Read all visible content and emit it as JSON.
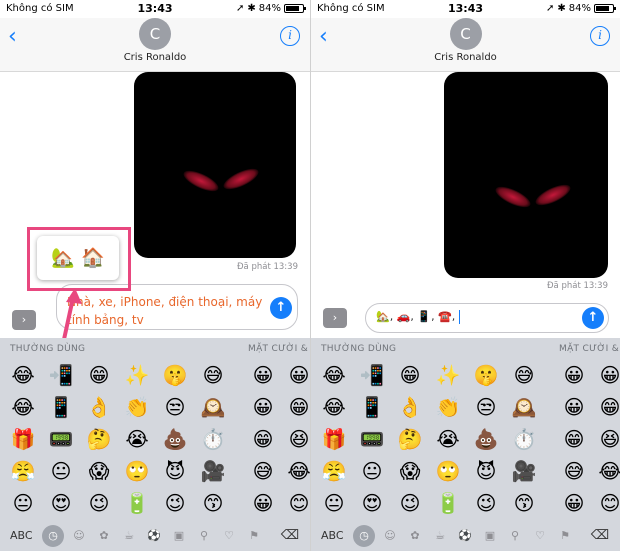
{
  "status": {
    "carrier": "Không có SIM",
    "time": "13:43",
    "battery": "84%",
    "battery_level": 0.84
  },
  "header": {
    "avatar_letter": "C",
    "contact_name": "Cris Ronaldo",
    "back_icon": "chevron-left-icon",
    "info_icon": "info-icon"
  },
  "message": {
    "delivered_left": "Đã phát  13:39",
    "delivered_right": "Đã phát  13:39"
  },
  "input_left": {
    "text": "Nhà, xe, iPhone, điện thoại, máy tính bảng, tv"
  },
  "input_right": {
    "text": "🏡, 🚗, 📱, ☎️, "
  },
  "suggestion": {
    "emojis": "🏡 🏠"
  },
  "keyboard": {
    "category_frequent": "THƯỜNG DÙNG",
    "category_smileys": "MẶT CƯỜI &",
    "abc_label": "ABC",
    "emoji_rows": [
      [
        "😂",
        "📲",
        "😁",
        "✨",
        "🤫",
        "😅"
      ],
      [
        "😂",
        "📱",
        "👌",
        "👏",
        "😒",
        "🕰️"
      ],
      [
        "🎁",
        "📟",
        "🤔",
        "😭",
        "💩",
        "⏱️"
      ],
      [
        "😤",
        "😐",
        "😱",
        "🙄",
        "😈",
        "🎥"
      ],
      [
        "😐",
        "😍",
        "😉",
        "🔋",
        "😉",
        "😙"
      ]
    ],
    "emoji_rows_right_partial": [
      [
        "😀",
        "😀"
      ],
      [
        "😀",
        "😁"
      ],
      [
        "😁",
        "😆"
      ],
      [
        "😅",
        "😂"
      ],
      [
        "😀",
        "😊"
      ]
    ],
    "category_icons": [
      "clock-icon",
      "smiley-icon",
      "animal-icon",
      "food-icon",
      "sport-icon",
      "car-icon",
      "bulb-icon",
      "symbol-icon",
      "flag-icon"
    ]
  }
}
